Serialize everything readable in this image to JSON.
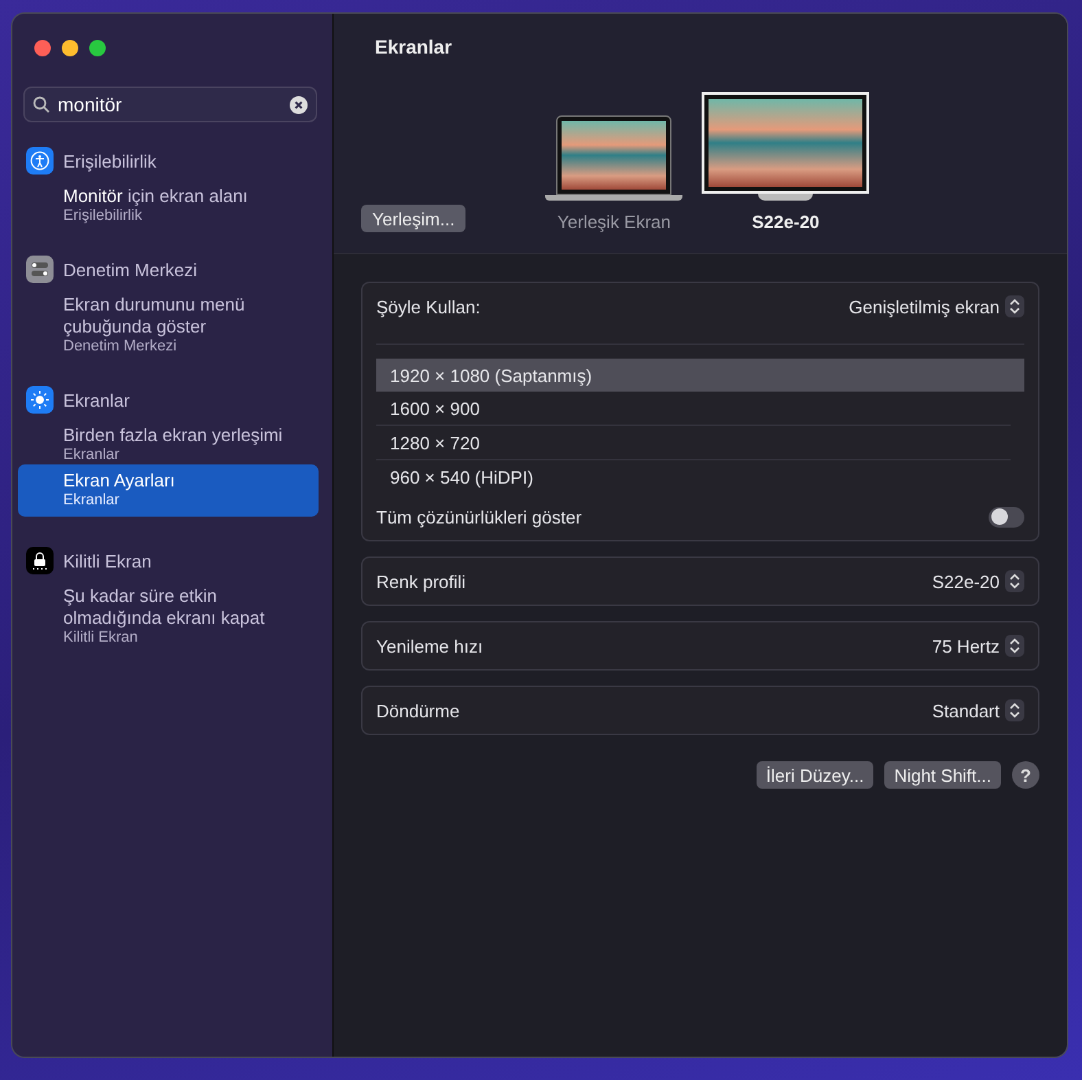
{
  "search": {
    "value": "monitör"
  },
  "sidebar": {
    "groups": [
      {
        "kind": "accessibility",
        "title": "Erişilebilirlik",
        "results": [
          {
            "title": "**Monitör** için ekran alanı",
            "subtitle": "Erişilebilirlik",
            "selected": false
          }
        ]
      },
      {
        "kind": "control-center",
        "title": "Denetim Merkezi",
        "results": [
          {
            "title": "Ekran durumunu menü çubuğunda göster",
            "subtitle": "Denetim Merkezi",
            "selected": false
          }
        ]
      },
      {
        "kind": "displays",
        "title": "Ekranlar",
        "results": [
          {
            "title": "Birden fazla ekran yerleşimi",
            "subtitle": "Ekranlar",
            "selected": false
          },
          {
            "title": "Ekran Ayarları",
            "subtitle": "Ekranlar",
            "selected": true
          }
        ]
      },
      {
        "kind": "lock",
        "title": "Kilitli Ekran",
        "results": [
          {
            "title": "Şu kadar süre etkin olmadığında ekranı kapat",
            "subtitle": "Kilitli Ekran",
            "selected": false
          }
        ]
      }
    ]
  },
  "main": {
    "title": "Ekranlar",
    "arrange_button": "Yerleşim...",
    "displays": [
      {
        "kind": "laptop",
        "name": "Yerleşik Ekran",
        "selected": false
      },
      {
        "kind": "monitor",
        "name": "S22e-20",
        "selected": true
      }
    ],
    "use_as": {
      "label": "Şöyle Kullan:",
      "value": "Genişletilmiş ekran"
    },
    "resolutions": [
      {
        "label": "1920 × 1080 (Saptanmış)",
        "selected": true
      },
      {
        "label": "1600 × 900",
        "selected": false
      },
      {
        "label": "1280 × 720",
        "selected": false
      },
      {
        "label": "960 × 540 (HiDPI)",
        "selected": false
      }
    ],
    "show_all": {
      "label": "Tüm çözünürlükleri göster",
      "on": false
    },
    "settings": [
      {
        "label": "Renk profili",
        "value": "S22e-20"
      },
      {
        "label": "Yenileme hızı",
        "value": "75 Hertz"
      },
      {
        "label": "Döndürme",
        "value": "Standart"
      }
    ],
    "buttons": [
      "İleri Düzey...",
      "Night Shift..."
    ],
    "help": "?"
  }
}
